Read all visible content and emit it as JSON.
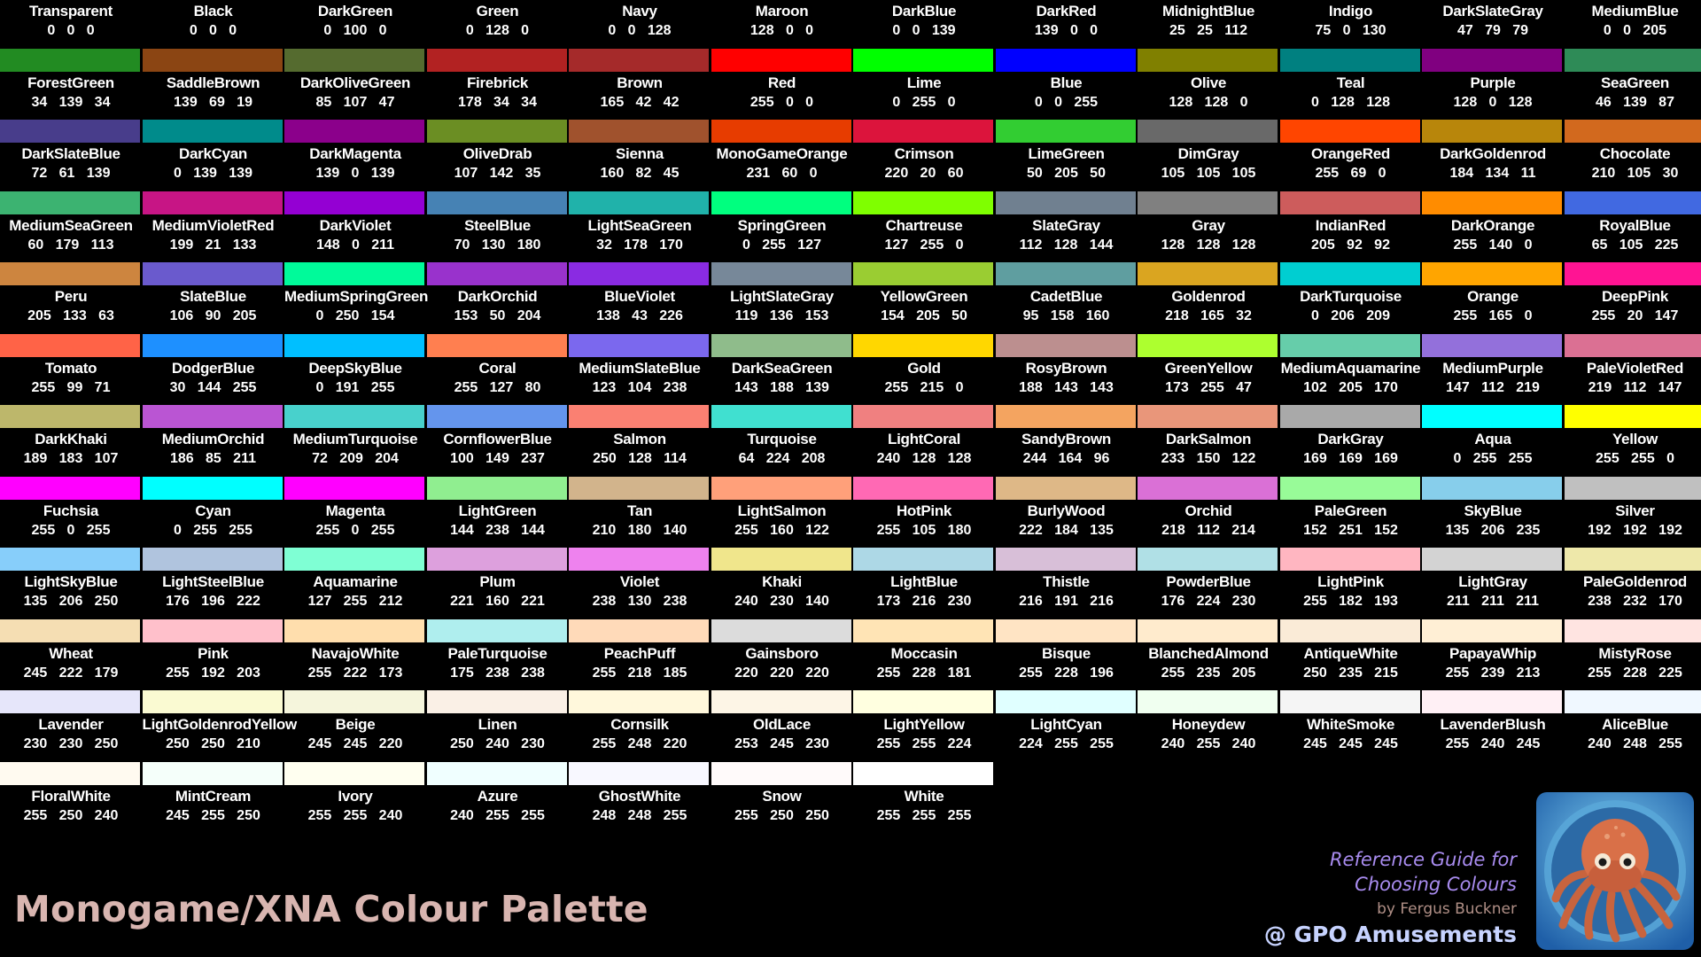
{
  "title": "Monogame/XNA Colour Palette",
  "guide": {
    "line1": "Reference Guide for",
    "line2": "Choosing Colours",
    "author": "by Fergus Buckner",
    "studio": "@ GPO Amusements"
  },
  "colors": [
    {
      "name": "Transparent",
      "r": 0,
      "g": 0,
      "b": 0,
      "hex": "#000000"
    },
    {
      "name": "Black",
      "r": 0,
      "g": 0,
      "b": 0,
      "hex": "#000000"
    },
    {
      "name": "DarkGreen",
      "r": 0,
      "g": 100,
      "b": 0,
      "hex": "#006400"
    },
    {
      "name": "Green",
      "r": 0,
      "g": 128,
      "b": 0,
      "hex": "#008000"
    },
    {
      "name": "Navy",
      "r": 0,
      "g": 0,
      "b": 128,
      "hex": "#000080"
    },
    {
      "name": "Maroon",
      "r": 128,
      "g": 0,
      "b": 0,
      "hex": "#800000"
    },
    {
      "name": "DarkBlue",
      "r": 0,
      "g": 0,
      "b": 139,
      "hex": "#00008b"
    },
    {
      "name": "DarkRed",
      "r": 139,
      "g": 0,
      "b": 0,
      "hex": "#8b0000"
    },
    {
      "name": "MidnightBlue",
      "r": 25,
      "g": 25,
      "b": 112,
      "hex": "#191970"
    },
    {
      "name": "Indigo",
      "r": 75,
      "g": 0,
      "b": 130,
      "hex": "#4b0082"
    },
    {
      "name": "DarkSlateGray",
      "r": 47,
      "g": 79,
      "b": 79,
      "hex": "#2f4f4f"
    },
    {
      "name": "MediumBlue",
      "r": 0,
      "g": 0,
      "b": 205,
      "hex": "#0000cd"
    },
    {
      "name": "ForestGreen",
      "r": 34,
      "g": 139,
      "b": 34,
      "hex": "#228b22"
    },
    {
      "name": "SaddleBrown",
      "r": 139,
      "g": 69,
      "b": 19,
      "hex": "#8b4513"
    },
    {
      "name": "DarkOliveGreen",
      "r": 85,
      "g": 107,
      "b": 47,
      "hex": "#556b2f"
    },
    {
      "name": "Firebrick",
      "r": 178,
      "g": 34,
      "b": 34,
      "hex": "#b22222"
    },
    {
      "name": "Brown",
      "r": 165,
      "g": 42,
      "b": 42,
      "hex": "#a52a2a"
    },
    {
      "name": "Red",
      "r": 255,
      "g": 0,
      "b": 0,
      "hex": "#ff0000"
    },
    {
      "name": "Lime",
      "r": 0,
      "g": 255,
      "b": 0,
      "hex": "#00ff00"
    },
    {
      "name": "Blue",
      "r": 0,
      "g": 0,
      "b": 255,
      "hex": "#0000ff"
    },
    {
      "name": "Olive",
      "r": 128,
      "g": 128,
      "b": 0,
      "hex": "#808000"
    },
    {
      "name": "Teal",
      "r": 0,
      "g": 128,
      "b": 128,
      "hex": "#008080"
    },
    {
      "name": "Purple",
      "r": 128,
      "g": 0,
      "b": 128,
      "hex": "#800080"
    },
    {
      "name": "SeaGreen",
      "r": 46,
      "g": 139,
      "b": 87,
      "hex": "#2e8b57"
    },
    {
      "name": "DarkSlateBlue",
      "r": 72,
      "g": 61,
      "b": 139,
      "hex": "#483d8b"
    },
    {
      "name": "DarkCyan",
      "r": 0,
      "g": 139,
      "b": 139,
      "hex": "#008b8b"
    },
    {
      "name": "DarkMagenta",
      "r": 139,
      "g": 0,
      "b": 139,
      "hex": "#8b008b"
    },
    {
      "name": "OliveDrab",
      "r": 107,
      "g": 142,
      "b": 35,
      "hex": "#6b8e23"
    },
    {
      "name": "Sienna",
      "r": 160,
      "g": 82,
      "b": 45,
      "hex": "#a0522d"
    },
    {
      "name": "MonoGameOrange",
      "r": 231,
      "g": 60,
      "b": 0,
      "hex": "#e73c00"
    },
    {
      "name": "Crimson",
      "r": 220,
      "g": 20,
      "b": 60,
      "hex": "#dc143c"
    },
    {
      "name": "LimeGreen",
      "r": 50,
      "g": 205,
      "b": 50,
      "hex": "#32cd32"
    },
    {
      "name": "DimGray",
      "r": 105,
      "g": 105,
      "b": 105,
      "hex": "#696969"
    },
    {
      "name": "OrangeRed",
      "r": 255,
      "g": 69,
      "b": 0,
      "hex": "#ff4500"
    },
    {
      "name": "DarkGoldenrod",
      "r": 184,
      "g": 134,
      "b": 11,
      "hex": "#b8860b"
    },
    {
      "name": "Chocolate",
      "r": 210,
      "g": 105,
      "b": 30,
      "hex": "#d2691e"
    },
    {
      "name": "MediumSeaGreen",
      "r": 60,
      "g": 179,
      "b": 113,
      "hex": "#3cb371"
    },
    {
      "name": "MediumVioletRed",
      "r": 199,
      "g": 21,
      "b": 133,
      "hex": "#c71585"
    },
    {
      "name": "DarkViolet",
      "r": 148,
      "g": 0,
      "b": 211,
      "hex": "#9400d3"
    },
    {
      "name": "SteelBlue",
      "r": 70,
      "g": 130,
      "b": 180,
      "hex": "#4682b4"
    },
    {
      "name": "LightSeaGreen",
      "r": 32,
      "g": 178,
      "b": 170,
      "hex": "#20b2aa"
    },
    {
      "name": "SpringGreen",
      "r": 0,
      "g": 255,
      "b": 127,
      "hex": "#00ff7f"
    },
    {
      "name": "Chartreuse",
      "r": 127,
      "g": 255,
      "b": 0,
      "hex": "#7fff00"
    },
    {
      "name": "SlateGray",
      "r": 112,
      "g": 128,
      "b": 144,
      "hex": "#708090"
    },
    {
      "name": "Gray",
      "r": 128,
      "g": 128,
      "b": 128,
      "hex": "#808080"
    },
    {
      "name": "IndianRed",
      "r": 205,
      "g": 92,
      "b": 92,
      "hex": "#cd5c5c"
    },
    {
      "name": "DarkOrange",
      "r": 255,
      "g": 140,
      "b": 0,
      "hex": "#ff8c00"
    },
    {
      "name": "RoyalBlue",
      "r": 65,
      "g": 105,
      "b": 225,
      "hex": "#4169e1"
    },
    {
      "name": "Peru",
      "r": 205,
      "g": 133,
      "b": 63,
      "hex": "#cd853f"
    },
    {
      "name": "SlateBlue",
      "r": 106,
      "g": 90,
      "b": 205,
      "hex": "#6a5acd"
    },
    {
      "name": "MediumSpringGreen",
      "r": 0,
      "g": 250,
      "b": 154,
      "hex": "#00fa9a"
    },
    {
      "name": "DarkOrchid",
      "r": 153,
      "g": 50,
      "b": 204,
      "hex": "#9932cc"
    },
    {
      "name": "BlueViolet",
      "r": 138,
      "g": 43,
      "b": 226,
      "hex": "#8a2be2"
    },
    {
      "name": "LightSlateGray",
      "r": 119,
      "g": 136,
      "b": 153,
      "hex": "#778899"
    },
    {
      "name": "YellowGreen",
      "r": 154,
      "g": 205,
      "b": 50,
      "hex": "#9acd32"
    },
    {
      "name": "CadetBlue",
      "r": 95,
      "g": 158,
      "b": 160,
      "hex": "#5f9ea0"
    },
    {
      "name": "Goldenrod",
      "r": 218,
      "g": 165,
      "b": 32,
      "hex": "#daa520"
    },
    {
      "name": "DarkTurquoise",
      "r": 0,
      "g": 206,
      "b": 209,
      "hex": "#00ced1"
    },
    {
      "name": "Orange",
      "r": 255,
      "g": 165,
      "b": 0,
      "hex": "#ffa500"
    },
    {
      "name": "DeepPink",
      "r": 255,
      "g": 20,
      "b": 147,
      "hex": "#ff1493"
    },
    {
      "name": "Tomato",
      "r": 255,
      "g": 99,
      "b": 71,
      "hex": "#ff6347"
    },
    {
      "name": "DodgerBlue",
      "r": 30,
      "g": 144,
      "b": 255,
      "hex": "#1e90ff"
    },
    {
      "name": "DeepSkyBlue",
      "r": 0,
      "g": 191,
      "b": 255,
      "hex": "#00bfff"
    },
    {
      "name": "Coral",
      "r": 255,
      "g": 127,
      "b": 80,
      "hex": "#ff7f50"
    },
    {
      "name": "MediumSlateBlue",
      "r": 123,
      "g": 104,
      "b": 238,
      "hex": "#7b68ee"
    },
    {
      "name": "DarkSeaGreen",
      "r": 143,
      "g": 188,
      "b": 139,
      "hex": "#8fbc8b"
    },
    {
      "name": "Gold",
      "r": 255,
      "g": 215,
      "b": 0,
      "hex": "#ffd700"
    },
    {
      "name": "RosyBrown",
      "r": 188,
      "g": 143,
      "b": 143,
      "hex": "#bc8f8f"
    },
    {
      "name": "GreenYellow",
      "r": 173,
      "g": 255,
      "b": 47,
      "hex": "#adff2f"
    },
    {
      "name": "MediumAquamarine",
      "r": 102,
      "g": 205,
      "b": 170,
      "hex": "#66cdaa"
    },
    {
      "name": "MediumPurple",
      "r": 147,
      "g": 112,
      "b": 219,
      "hex": "#9370db"
    },
    {
      "name": "PaleVioletRed",
      "r": 219,
      "g": 112,
      "b": 147,
      "hex": "#db7093"
    },
    {
      "name": "DarkKhaki",
      "r": 189,
      "g": 183,
      "b": 107,
      "hex": "#bdb76b"
    },
    {
      "name": "MediumOrchid",
      "r": 186,
      "g": 85,
      "b": 211,
      "hex": "#ba55d3"
    },
    {
      "name": "MediumTurquoise",
      "r": 72,
      "g": 209,
      "b": 204,
      "hex": "#48d1cc"
    },
    {
      "name": "CornflowerBlue",
      "r": 100,
      "g": 149,
      "b": 237,
      "hex": "#6495ed"
    },
    {
      "name": "Salmon",
      "r": 250,
      "g": 128,
      "b": 114,
      "hex": "#fa8072"
    },
    {
      "name": "Turquoise",
      "r": 64,
      "g": 224,
      "b": 208,
      "hex": "#40e0d0"
    },
    {
      "name": "LightCoral",
      "r": 240,
      "g": 128,
      "b": 128,
      "hex": "#f08080"
    },
    {
      "name": "SandyBrown",
      "r": 244,
      "g": 164,
      "b": 96,
      "hex": "#f4a460"
    },
    {
      "name": "DarkSalmon",
      "r": 233,
      "g": 150,
      "b": 122,
      "hex": "#e9967a"
    },
    {
      "name": "DarkGray",
      "r": 169,
      "g": 169,
      "b": 169,
      "hex": "#a9a9a9"
    },
    {
      "name": "Aqua",
      "r": 0,
      "g": 255,
      "b": 255,
      "hex": "#00ffff"
    },
    {
      "name": "Yellow",
      "r": 255,
      "g": 255,
      "b": 0,
      "hex": "#ffff00"
    },
    {
      "name": "Fuchsia",
      "r": 255,
      "g": 0,
      "b": 255,
      "hex": "#ff00ff"
    },
    {
      "name": "Cyan",
      "r": 0,
      "g": 255,
      "b": 255,
      "hex": "#00ffff"
    },
    {
      "name": "Magenta",
      "r": 255,
      "g": 0,
      "b": 255,
      "hex": "#ff00ff"
    },
    {
      "name": "LightGreen",
      "r": 144,
      "g": 238,
      "b": 144,
      "hex": "#90ee90"
    },
    {
      "name": "Tan",
      "r": 210,
      "g": 180,
      "b": 140,
      "hex": "#d2b48c"
    },
    {
      "name": "LightSalmon",
      "r": 255,
      "g": 160,
      "b": 122,
      "hex": "#ffa07a"
    },
    {
      "name": "HotPink",
      "r": 255,
      "g": 105,
      "b": 180,
      "hex": "#ff69b4"
    },
    {
      "name": "BurlyWood",
      "r": 222,
      "g": 184,
      "b": 135,
      "hex": "#deb887"
    },
    {
      "name": "Orchid",
      "r": 218,
      "g": 112,
      "b": 214,
      "hex": "#da70d6"
    },
    {
      "name": "PaleGreen",
      "r": 152,
      "g": 251,
      "b": 152,
      "hex": "#98fb98"
    },
    {
      "name": "SkyBlue",
      "r": 135,
      "g": 206,
      "b": 235,
      "hex": "#87ceeb"
    },
    {
      "name": "Silver",
      "r": 192,
      "g": 192,
      "b": 192,
      "hex": "#c0c0c0"
    },
    {
      "name": "LightSkyBlue",
      "r": 135,
      "g": 206,
      "b": 250,
      "hex": "#87cefa"
    },
    {
      "name": "LightSteelBlue",
      "r": 176,
      "g": 196,
      "b": 222,
      "hex": "#b0c4de"
    },
    {
      "name": "Aquamarine",
      "r": 127,
      "g": 255,
      "b": 212,
      "hex": "#7fffd4"
    },
    {
      "name": "Plum",
      "r": 221,
      "g": 160,
      "b": 221,
      "hex": "#dda0dd"
    },
    {
      "name": "Violet",
      "r": 238,
      "g": 130,
      "b": 238,
      "hex": "#ee82ee"
    },
    {
      "name": "Khaki",
      "r": 240,
      "g": 230,
      "b": 140,
      "hex": "#f0e68c"
    },
    {
      "name": "LightBlue",
      "r": 173,
      "g": 216,
      "b": 230,
      "hex": "#add8e6"
    },
    {
      "name": "Thistle",
      "r": 216,
      "g": 191,
      "b": 216,
      "hex": "#d8bfd8"
    },
    {
      "name": "PowderBlue",
      "r": 176,
      "g": 224,
      "b": 230,
      "hex": "#b0e0e6"
    },
    {
      "name": "LightPink",
      "r": 255,
      "g": 182,
      "b": 193,
      "hex": "#ffb6c1"
    },
    {
      "name": "LightGray",
      "r": 211,
      "g": 211,
      "b": 211,
      "hex": "#d3d3d3"
    },
    {
      "name": "PaleGoldenrod",
      "r": 238,
      "g": 232,
      "b": 170,
      "hex": "#eee8aa"
    },
    {
      "name": "Wheat",
      "r": 245,
      "g": 222,
      "b": 179,
      "hex": "#f5deb3"
    },
    {
      "name": "Pink",
      "r": 255,
      "g": 192,
      "b": 203,
      "hex": "#ffc0cb"
    },
    {
      "name": "NavajoWhite",
      "r": 255,
      "g": 222,
      "b": 173,
      "hex": "#ffdead"
    },
    {
      "name": "PaleTurquoise",
      "r": 175,
      "g": 238,
      "b": 238,
      "hex": "#afeeee"
    },
    {
      "name": "PeachPuff",
      "r": 255,
      "g": 218,
      "b": 185,
      "hex": "#ffdab9"
    },
    {
      "name": "Gainsboro",
      "r": 220,
      "g": 220,
      "b": 220,
      "hex": "#dcdcdc"
    },
    {
      "name": "Moccasin",
      "r": 255,
      "g": 228,
      "b": 181,
      "hex": "#ffe4b5"
    },
    {
      "name": "Bisque",
      "r": 255,
      "g": 228,
      "b": 196,
      "hex": "#ffe4c4"
    },
    {
      "name": "BlanchedAlmond",
      "r": 255,
      "g": 235,
      "b": 205,
      "hex": "#ffebcd"
    },
    {
      "name": "AntiqueWhite",
      "r": 250,
      "g": 235,
      "b": 215,
      "hex": "#faebd7"
    },
    {
      "name": "PapayaWhip",
      "r": 255,
      "g": 239,
      "b": 213,
      "hex": "#ffefd5"
    },
    {
      "name": "MistyRose",
      "r": 255,
      "g": 228,
      "b": 225,
      "hex": "#ffe4e1"
    },
    {
      "name": "Lavender",
      "r": 230,
      "g": 230,
      "b": 250,
      "hex": "#e6e6fa"
    },
    {
      "name": "LightGoldenrodYellow",
      "r": 250,
      "g": 250,
      "b": 210,
      "hex": "#fafad2"
    },
    {
      "name": "Beige",
      "r": 245,
      "g": 245,
      "b": 220,
      "hex": "#f5f5dc"
    },
    {
      "name": "Linen",
      "r": 250,
      "g": 240,
      "b": 230,
      "hex": "#faf0e6"
    },
    {
      "name": "Cornsilk",
      "r": 255,
      "g": 248,
      "b": 220,
      "hex": "#fff8dc"
    },
    {
      "name": "OldLace",
      "r": 253,
      "g": 245,
      "b": 230,
      "hex": "#fdf5e6"
    },
    {
      "name": "LightYellow",
      "r": 255,
      "g": 255,
      "b": 224,
      "hex": "#ffffe0"
    },
    {
      "name": "LightCyan",
      "r": 224,
      "g": 255,
      "b": 255,
      "hex": "#e0ffff"
    },
    {
      "name": "Honeydew",
      "r": 240,
      "g": 255,
      "b": 240,
      "hex": "#f0fff0"
    },
    {
      "name": "WhiteSmoke",
      "r": 245,
      "g": 245,
      "b": 245,
      "hex": "#f5f5f5"
    },
    {
      "name": "LavenderBlush",
      "r": 255,
      "g": 240,
      "b": 245,
      "hex": "#fff0f5"
    },
    {
      "name": "AliceBlue",
      "r": 240,
      "g": 248,
      "b": 255,
      "hex": "#f0f8ff"
    },
    {
      "name": "FloralWhite",
      "r": 255,
      "g": 250,
      "b": 240,
      "hex": "#fffaf0"
    },
    {
      "name": "MintCream",
      "r": 245,
      "g": 255,
      "b": 250,
      "hex": "#f5fffa"
    },
    {
      "name": "Ivory",
      "r": 255,
      "g": 255,
      "b": 240,
      "hex": "#fffff0"
    },
    {
      "name": "Azure",
      "r": 240,
      "g": 255,
      "b": 255,
      "hex": "#f0ffff"
    },
    {
      "name": "GhostWhite",
      "r": 248,
      "g": 248,
      "b": 255,
      "hex": "#f8f8ff"
    },
    {
      "name": "Snow",
      "r": 255,
      "g": 250,
      "b": 250,
      "hex": "#fffafa"
    },
    {
      "name": "White",
      "r": 255,
      "g": 255,
      "b": 255,
      "hex": "#ffffff"
    }
  ]
}
